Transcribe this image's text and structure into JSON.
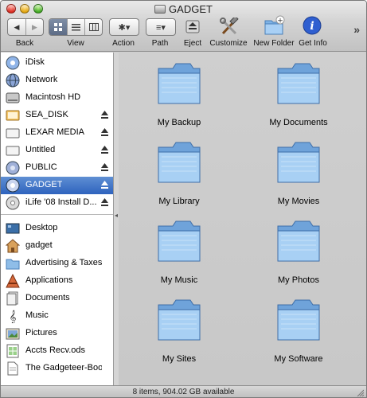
{
  "window": {
    "title": "GADGET"
  },
  "toolbar": {
    "back_label": "Back",
    "view_label": "View",
    "action_label": "Action",
    "path_label": "Path",
    "eject_label": "Eject",
    "customize_label": "Customize",
    "new_folder_label": "New Folder",
    "get_info_label": "Get Info",
    "overflow_glyph": "»",
    "back_glyph": "◀",
    "forward_glyph": "▶",
    "action_glyph": "✱▾",
    "path_glyph": "≡▾"
  },
  "sidebar": {
    "items": [
      {
        "label": "iDisk",
        "icon": "idisk-icon",
        "eject": false,
        "selected": false
      },
      {
        "label": "Network",
        "icon": "network-globe-icon",
        "eject": false,
        "selected": false
      },
      {
        "label": "Macintosh HD",
        "icon": "hard-drive-icon",
        "eject": false,
        "selected": false
      },
      {
        "label": "SEA_DISK",
        "icon": "external-drive-icon",
        "eject": true,
        "selected": false
      },
      {
        "label": "LEXAR MEDIA",
        "icon": "removable-drive-icon",
        "eject": true,
        "selected": false
      },
      {
        "label": "Untitled",
        "icon": "removable-drive-icon",
        "eject": true,
        "selected": false
      },
      {
        "label": "PUBLIC",
        "icon": "network-drive-icon",
        "eject": true,
        "selected": false
      },
      {
        "label": "GADGET",
        "icon": "network-drive-icon",
        "eject": true,
        "selected": true
      },
      {
        "label": "iLife '08 Install D...",
        "icon": "dvd-icon",
        "eject": true,
        "selected": false
      },
      {
        "label": "Desktop",
        "icon": "desktop-icon",
        "eject": false,
        "selected": false
      },
      {
        "label": "gadget",
        "icon": "home-icon",
        "eject": false,
        "selected": false
      },
      {
        "label": "Advertising & Taxes",
        "icon": "folder-icon",
        "eject": false,
        "selected": false
      },
      {
        "label": "Applications",
        "icon": "applications-icon",
        "eject": false,
        "selected": false
      },
      {
        "label": "Documents",
        "icon": "documents-icon",
        "eject": false,
        "selected": false
      },
      {
        "label": "Music",
        "icon": "music-icon",
        "eject": false,
        "selected": false
      },
      {
        "label": "Pictures",
        "icon": "pictures-icon",
        "eject": false,
        "selected": false
      },
      {
        "label": "Accts Recv.ods",
        "icon": "spreadsheet-icon",
        "eject": false,
        "selected": false
      },
      {
        "label": "The Gadgeteer-Boo...",
        "icon": "document-file-icon",
        "eject": false,
        "selected": false
      }
    ]
  },
  "folders": [
    {
      "label": "My Backup"
    },
    {
      "label": "My Documents"
    },
    {
      "label": "My Library"
    },
    {
      "label": "My Movies"
    },
    {
      "label": "My Music"
    },
    {
      "label": "My Photos"
    },
    {
      "label": "My Sites"
    },
    {
      "label": "My Software"
    }
  ],
  "status": {
    "text": "8 items, 904.02 GB available"
  },
  "colors": {
    "selection": "#3a6fc6",
    "folder_blue": "#8fbde8"
  }
}
